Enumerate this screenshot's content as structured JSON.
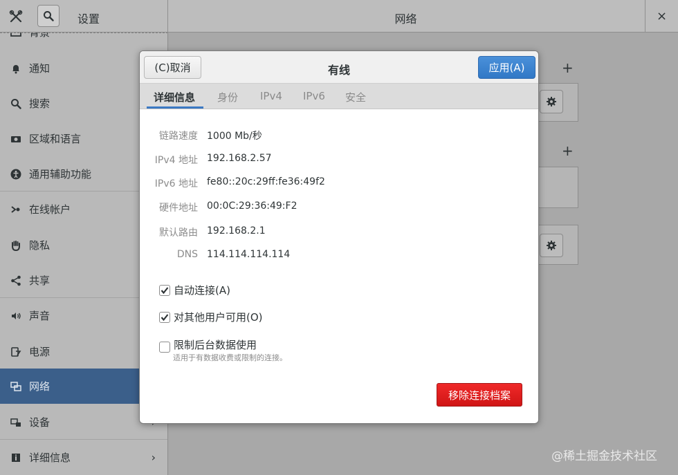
{
  "window": {
    "left_title": "设置",
    "title": "网络",
    "close_label": "×"
  },
  "sidebar": {
    "items": [
      {
        "label": "背景",
        "icon": "image-icon"
      },
      {
        "label": "通知",
        "icon": "bell-icon"
      },
      {
        "label": "搜索",
        "icon": "search-icon"
      },
      {
        "label": "区域和语言",
        "icon": "camera-icon"
      },
      {
        "label": "通用辅助功能",
        "icon": "accessibility-icon"
      },
      {
        "label": "在线帐户",
        "icon": "online-accounts-icon"
      },
      {
        "label": "隐私",
        "icon": "hand-icon"
      },
      {
        "label": "共享",
        "icon": "share-icon"
      },
      {
        "label": "声音",
        "icon": "speaker-icon"
      },
      {
        "label": "电源",
        "icon": "battery-icon"
      },
      {
        "label": "网络",
        "icon": "network-icon"
      },
      {
        "label": "设备",
        "icon": "devices-icon"
      },
      {
        "label": "详细信息",
        "icon": "info-icon"
      }
    ],
    "chevron": "›"
  },
  "main": {
    "plus": "+"
  },
  "dialog": {
    "cancel_label": "(C)取消",
    "title": "有线",
    "apply_label": "应用(A)",
    "tabs": [
      {
        "label": "详细信息"
      },
      {
        "label": "身份"
      },
      {
        "label": "IPv4"
      },
      {
        "label": "IPv6"
      },
      {
        "label": "安全"
      }
    ],
    "details": [
      {
        "label": "链路速度",
        "value": "1000 Mb/秒"
      },
      {
        "label": "IPv4 地址",
        "value": "192.168.2.57"
      },
      {
        "label": "IPv6 地址",
        "value": "fe80::20c:29ff:fe36:49f2"
      },
      {
        "label": "硬件地址",
        "value": "00:0C:29:36:49:F2"
      },
      {
        "label": "默认路由",
        "value": "192.168.2.1"
      },
      {
        "label": "DNS",
        "value": "114.114.114.114"
      }
    ],
    "checkboxes": [
      {
        "label": "自动连接(A)",
        "checked": true
      },
      {
        "label": "对其他用户可用(O)",
        "checked": true
      },
      {
        "label": "限制后台数据使用",
        "checked": false,
        "sublabel": "适用于有数据收费或限制的连接。"
      }
    ],
    "remove_label": "移除连接档案"
  },
  "colors": {
    "accent": "#3b79c3",
    "apply_button": "#3a83d2",
    "remove_button": "#e01b1b",
    "sidebar_active": "#3b5f8a"
  },
  "watermark": "@稀土掘金技术社区"
}
